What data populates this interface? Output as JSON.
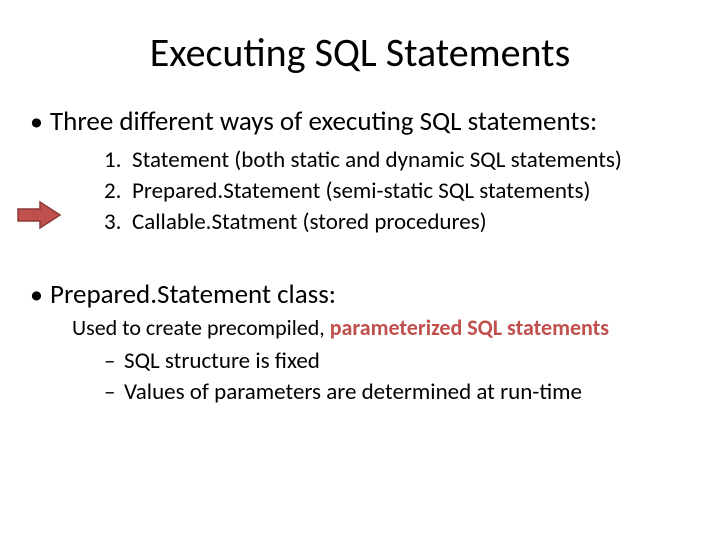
{
  "title": "Executing SQL Statements",
  "bullet1": "Three different ways of executing SQL statements:",
  "num1": "Statement (both static and dynamic SQL statements)",
  "num2": "Prepared.Statement (semi-static SQL statements)",
  "num3": "Callable.Statment (stored procedures)",
  "bullet2": "Prepared.Statement class:",
  "sub_plain": "Used to create precompiled, ",
  "sub_accent": "parameterized SQL statements",
  "dash1": "SQL structure is fixed",
  "dash2": "Values of parameters are determined at run-time",
  "arrow_fill": "#C0504D",
  "arrow_stroke": "#8B3A38"
}
